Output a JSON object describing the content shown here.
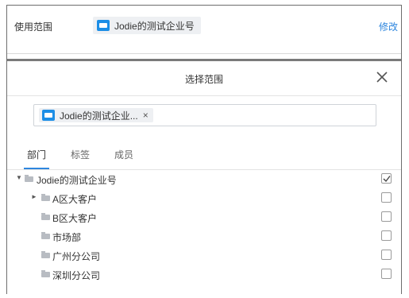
{
  "scope": {
    "label": "使用范围",
    "chip": "Jodie的测试企业号",
    "edit": "修改"
  },
  "dialog": {
    "title": "选择范围",
    "selected_chip": "Jodie的测试企业...",
    "remove": "×"
  },
  "tabs": [
    {
      "label": "部门",
      "active": true
    },
    {
      "label": "标签",
      "active": false
    },
    {
      "label": "成员",
      "active": false
    }
  ],
  "tree": [
    {
      "label": "Jodie的测试企业号",
      "toggle": "▼",
      "level": 0,
      "checked": true
    },
    {
      "label": "A区大客户",
      "toggle": "►",
      "level": 1,
      "checked": false
    },
    {
      "label": "B区大客户",
      "toggle": "",
      "level": 1,
      "checked": false
    },
    {
      "label": "市场部",
      "toggle": "",
      "level": 1,
      "checked": false
    },
    {
      "label": "广州分公司",
      "toggle": "",
      "level": 1,
      "checked": false
    },
    {
      "label": "深圳分公司",
      "toggle": "",
      "level": 1,
      "checked": false
    }
  ],
  "icons": {
    "chip_icon": "folder-icon",
    "close": "close-icon",
    "tree_icon": "folder-icon",
    "check": "checkmark-icon"
  },
  "colors": {
    "accent": "#2e86de",
    "folder": "#1c8ee6"
  }
}
